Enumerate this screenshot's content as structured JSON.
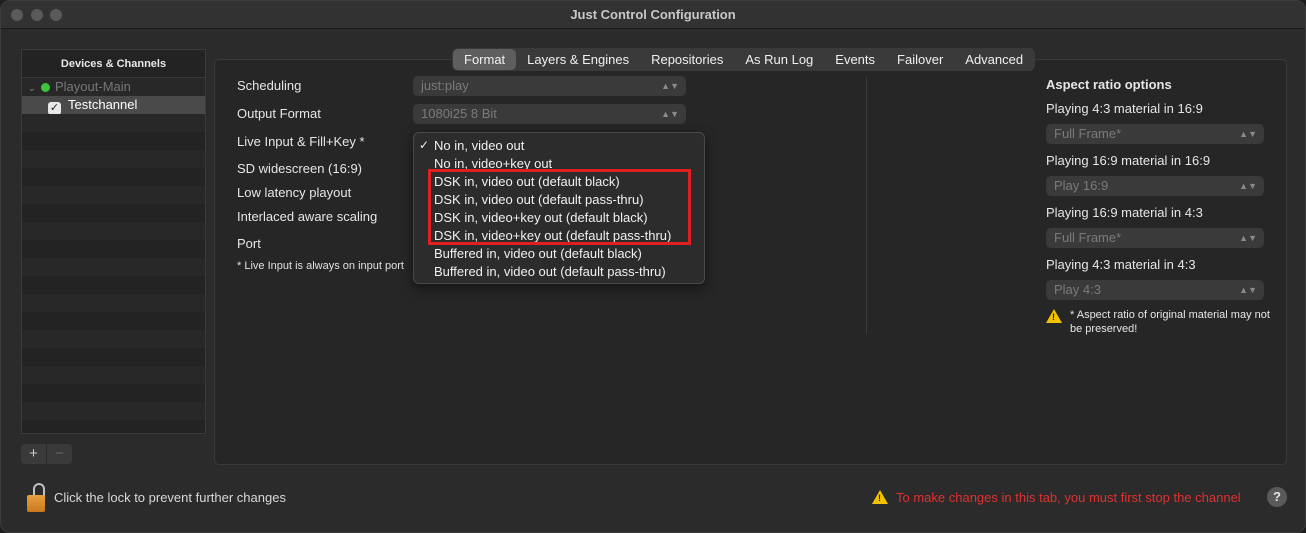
{
  "window": {
    "title": "Just Control Configuration"
  },
  "sidebar": {
    "header": "Devices & Channels",
    "device": {
      "name": "Playout-Main",
      "status_color": "#3cc43c"
    },
    "channel": {
      "name": "Testchannel",
      "checked": true
    },
    "add_label": "+",
    "remove_label": "−"
  },
  "tabs": [
    {
      "label": "Format",
      "active": true
    },
    {
      "label": "Layers & Engines"
    },
    {
      "label": "Repositories"
    },
    {
      "label": "As Run Log"
    },
    {
      "label": "Events"
    },
    {
      "label": "Failover"
    },
    {
      "label": "Advanced"
    }
  ],
  "format": {
    "scheduling_label": "Scheduling",
    "scheduling_value": "just:play",
    "output_format_label": "Output Format",
    "output_format_value": "1080i25 8 Bit",
    "live_input_label": "Live Input & Fill+Key *",
    "sd_widescreen_label": "SD widescreen (16:9)",
    "low_latency_label": "Low latency playout",
    "interlaced_label": "Interlaced aware scaling",
    "port_label": "Port",
    "footnote": "* Live Input is always on input port"
  },
  "live_input_menu": {
    "check_mark": "✓",
    "options": [
      "No in, video out",
      "No in, video+key out",
      "DSK in, video out (default black)",
      "DSK in, video out (default pass-thru)",
      "DSK in, video+key out (default black)",
      "DSK in, video+key out (default pass-thru)",
      "Buffered in, video out (default black)",
      "Buffered in, video out (default pass-thru)"
    ]
  },
  "aspect": {
    "title": "Aspect ratio options",
    "rows": [
      {
        "label": "Playing 4:3 material in 16:9",
        "value": "Full Frame*"
      },
      {
        "label": "Playing 16:9 material in 16:9",
        "value": "Play 16:9"
      },
      {
        "label": "Playing 16:9 material in 4:3",
        "value": "Full Frame*"
      },
      {
        "label": "Playing 4:3 material in 4:3",
        "value": "Play 4:3"
      }
    ],
    "note": "* Aspect ratio of original material may not be preserved!"
  },
  "footer": {
    "lock_text": "Click the lock to prevent further changes",
    "stop_warning": "To make changes in this tab, you must first stop the channel",
    "help_label": "?"
  },
  "colors": {
    "warning_red": "#e03030",
    "warning_yellow": "#f2c200",
    "highlight": "#e02020"
  }
}
